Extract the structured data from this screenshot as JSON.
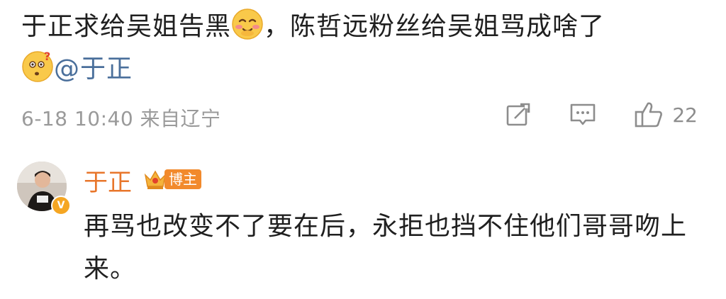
{
  "post": {
    "line1": "于正求给吴姐告黑",
    "line1_after_emoji": "，陈哲远粉丝给吴姐骂成啥了",
    "emoji1": "blush-emoji",
    "emoji2": "confused-emoji",
    "mention": "@于正",
    "meta": "6-18 10:40 来自辽宁",
    "like_count": "22"
  },
  "reply": {
    "name": "于正",
    "badge": "博主",
    "text": "再骂也改变不了要在后，永拒也挡不住他们哥哥吻上来。"
  },
  "colors": {
    "accent": "#e8762b",
    "mention": "#4a6f9b",
    "meta": "#9a9a9a"
  }
}
